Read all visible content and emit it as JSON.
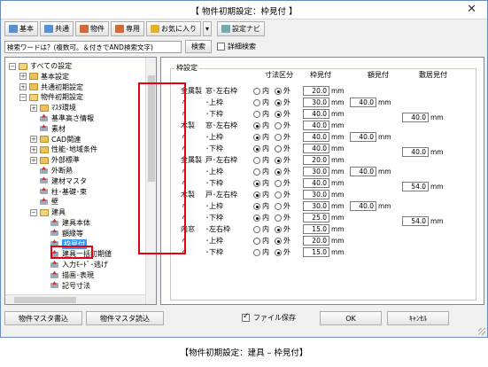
{
  "window": {
    "title": "【 物件初期設定：枠見付 】",
    "close_glyph": "✕"
  },
  "toolbar": {
    "buttons": [
      {
        "label": "基本",
        "icon": "book-icon"
      },
      {
        "label": "共通",
        "icon": "book-icon"
      },
      {
        "label": "物件",
        "icon": "house-icon"
      },
      {
        "label": "専用",
        "icon": "house-icon"
      },
      {
        "label": "お気に入り",
        "icon": "favorite-icon"
      },
      {
        "label": "▾",
        "icon": ""
      },
      {
        "label": "設定ナビ",
        "icon": "navi-icon"
      }
    ]
  },
  "search": {
    "placeholder": "検索ワードは？(複数可。＆付きでAND検索文字)",
    "button": "検索",
    "detail_label": "詳細検索",
    "detail_checked": false
  },
  "tree": {
    "nodes": [
      {
        "label": "すべての設定",
        "level": 0,
        "exp": "−",
        "kind": "folder"
      },
      {
        "label": "基本設定",
        "level": 1,
        "exp": "+",
        "kind": "folder"
      },
      {
        "label": "共通初期設定",
        "level": 1,
        "exp": "+",
        "kind": "folder"
      },
      {
        "label": "物件初期設定",
        "level": 1,
        "exp": "−",
        "kind": "folder"
      },
      {
        "label": "ﾏｽﾀ環境",
        "level": 2,
        "exp": "+",
        "kind": "folder"
      },
      {
        "label": "基準高さ情報",
        "level": 2,
        "exp": "",
        "kind": "item"
      },
      {
        "label": "素材",
        "level": 2,
        "exp": "",
        "kind": "item"
      },
      {
        "label": "CAD関連",
        "level": 2,
        "exp": "+",
        "kind": "folder"
      },
      {
        "label": "性能･地域条件",
        "level": 2,
        "exp": "+",
        "kind": "folder"
      },
      {
        "label": "外部標準",
        "level": 2,
        "exp": "+",
        "kind": "folder"
      },
      {
        "label": "外断熱",
        "level": 2,
        "exp": "",
        "kind": "item"
      },
      {
        "label": "建材マスタ",
        "level": 2,
        "exp": "",
        "kind": "item"
      },
      {
        "label": "柱･基礎･束",
        "level": 2,
        "exp": "",
        "kind": "item"
      },
      {
        "label": "壁",
        "level": 2,
        "exp": "",
        "kind": "item"
      },
      {
        "label": "建具",
        "level": 2,
        "exp": "−",
        "kind": "folder"
      },
      {
        "label": "建具本体",
        "level": 3,
        "exp": "",
        "kind": "item"
      },
      {
        "label": "額縁等",
        "level": 3,
        "exp": "",
        "kind": "item"
      },
      {
        "label": "枠見付",
        "level": 3,
        "exp": "",
        "kind": "item",
        "selected": true
      },
      {
        "label": "建具一括初期値",
        "level": 3,
        "exp": "",
        "kind": "item"
      },
      {
        "label": "入力ﾓｰﾄﾞ･逃げ",
        "level": 3,
        "exp": "",
        "kind": "item"
      },
      {
        "label": "描画･表現",
        "level": 3,
        "exp": "",
        "kind": "item"
      },
      {
        "label": "記号寸法",
        "level": 3,
        "exp": "",
        "kind": "item"
      }
    ]
  },
  "panel": {
    "group_title": "枠設定",
    "headers": {
      "dim": "寸法区分",
      "frame": "枠見付",
      "door": "額見付",
      "sill": "敷居見付"
    },
    "radio_in": "内",
    "radio_out": "外",
    "unit": "mm",
    "rows": [
      {
        "cat": "金属製",
        "part": "窓･左右枠",
        "choice": "out",
        "frame": "20.0",
        "door": "",
        "sill": ""
      },
      {
        "cat": "〃",
        "part": "･上枠",
        "choice": "out",
        "frame": "30.0",
        "door": "40.0",
        "sill": ""
      },
      {
        "cat": "〃",
        "part": "･下枠",
        "choice": "out",
        "frame": "40.0",
        "door": "",
        "sill": "40.0"
      },
      {
        "cat": "木製",
        "part": "窓･左右枠",
        "choice": "in",
        "frame": "40.0",
        "door": "",
        "sill": ""
      },
      {
        "cat": "〃",
        "part": "･上枠",
        "choice": "in",
        "frame": "40.0",
        "door": "40.0",
        "sill": ""
      },
      {
        "cat": "〃",
        "part": "･下枠",
        "choice": "in",
        "frame": "40.0",
        "door": "",
        "sill": "40.0"
      },
      {
        "cat": "金属製",
        "part": "戸･左右枠",
        "choice": "out",
        "frame": "20.0",
        "door": "",
        "sill": ""
      },
      {
        "cat": "〃",
        "part": "･上枠",
        "choice": "out",
        "frame": "30.0",
        "door": "40.0",
        "sill": ""
      },
      {
        "cat": "〃",
        "part": "･下枠",
        "choice": "in",
        "frame": "40.0",
        "door": "",
        "sill": "54.0"
      },
      {
        "cat": "木製",
        "part": "戸･左右枠",
        "choice": "in",
        "frame": "30.0",
        "door": "",
        "sill": ""
      },
      {
        "cat": "〃",
        "part": "･上枠",
        "choice": "in",
        "frame": "30.0",
        "door": "40.0",
        "sill": ""
      },
      {
        "cat": "〃",
        "part": "･下枠",
        "choice": "in",
        "frame": "25.0",
        "door": "",
        "sill": "54.0"
      },
      {
        "cat": "内窓",
        "part": "･左右枠",
        "choice": "out",
        "frame": "15.0",
        "door": "",
        "sill": ""
      },
      {
        "cat": "〃",
        "part": "･上枠",
        "choice": "out",
        "frame": "20.0",
        "door": "",
        "sill": ""
      },
      {
        "cat": "〃",
        "part": "･下枠",
        "choice": "out",
        "frame": "15.0",
        "door": "",
        "sill": ""
      }
    ]
  },
  "footer": {
    "master_write": "物件マスタ書込",
    "master_read": "物件マスタ読込",
    "save_label": "ファイル保存",
    "save_checked": true,
    "ok": "OK",
    "cancel": "ｷｬﾝｾﾙ"
  },
  "caption": "【物件初期設定：建具 – 枠見付】",
  "colors": {
    "highlight": "#e60012",
    "selection": "#3399ff",
    "folder": "#e9c25a"
  }
}
